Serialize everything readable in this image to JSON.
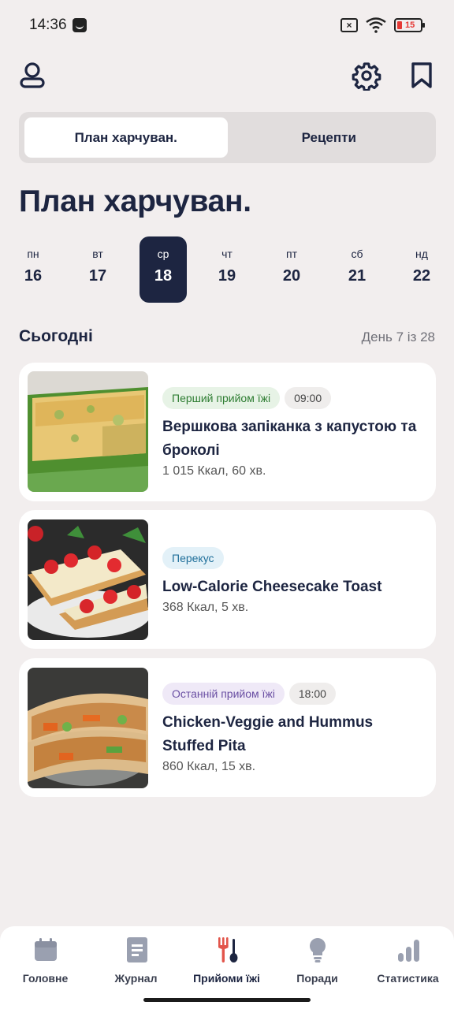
{
  "status_bar": {
    "time": "14:36",
    "battery": "15"
  },
  "tabs": [
    {
      "label": "План харчуван.",
      "active": true
    },
    {
      "label": "Рецепти",
      "active": false
    }
  ],
  "page_title": "План харчуван.",
  "week": [
    {
      "name": "пн",
      "date": "16"
    },
    {
      "name": "вт",
      "date": "17"
    },
    {
      "name": "ср",
      "date": "18",
      "selected": true
    },
    {
      "name": "чт",
      "date": "19"
    },
    {
      "name": "пт",
      "date": "20"
    },
    {
      "name": "сб",
      "date": "21"
    },
    {
      "name": "нд",
      "date": "22"
    }
  ],
  "section": {
    "title": "Сьогодні",
    "counter": "День 7 із 28"
  },
  "meals": [
    {
      "type": "Перший прийом їжі",
      "time": "09:00",
      "name": "Вершкова запіканка з капустою та броколі",
      "meta": "1 015 Ккал, 60 хв.",
      "chip_bg": "#e7f3e6",
      "chip_fg": "#2e7d32"
    },
    {
      "type": "Перекус",
      "time": "",
      "name": "Low-Calorie Cheesecake Toast",
      "meta": "368 Ккал, 5 хв.",
      "chip_bg": "#e3f1f8",
      "chip_fg": "#1f6f9a"
    },
    {
      "type": "Останній прийом їжі",
      "time": "18:00",
      "name": "Chicken-Veggie and Hummus Stuffed Pita",
      "meta": "860 Ккал, 15 хв.",
      "chip_bg": "#efe9f7",
      "chip_fg": "#6a4fa3"
    }
  ],
  "nav": [
    {
      "label": "Головне",
      "icon": "calendar-icon"
    },
    {
      "label": "Журнал",
      "icon": "journal-icon"
    },
    {
      "label": "Прийоми їжі",
      "icon": "fork-spoon-icon",
      "active": true
    },
    {
      "label": "Поради",
      "icon": "lightbulb-icon"
    },
    {
      "label": "Статистика",
      "icon": "bar-chart-icon"
    }
  ],
  "colors": {
    "accent": "#1d2541",
    "background": "#f2eeee",
    "active_nav_icon": "#e2554b"
  }
}
